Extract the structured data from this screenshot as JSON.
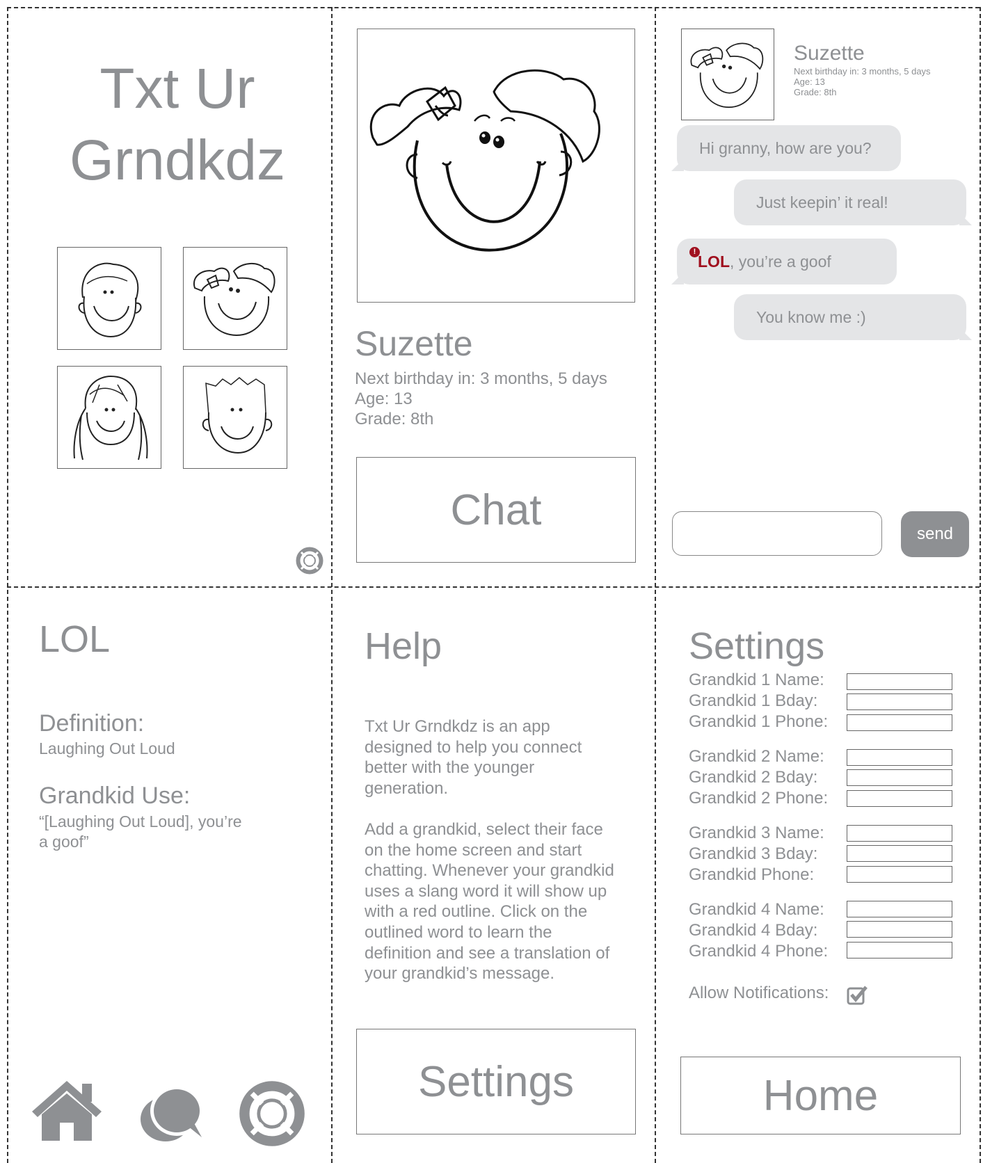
{
  "home": {
    "title_line1": "Txt Ur",
    "title_line2": "Grndkdz",
    "grandkids": [
      {
        "face": "boy-face-icon"
      },
      {
        "face": "girl-bow-face-icon"
      },
      {
        "face": "girl-pigtails-face-icon"
      },
      {
        "face": "boy-spiky-face-icon"
      }
    ],
    "help_icon": "lifebuoy-icon"
  },
  "profile": {
    "name": "Suzette",
    "birthday": "Next birthday in: 3 months, 5 days",
    "age": "Age: 13",
    "grade": "Grade: 8th",
    "chat_button": "Chat"
  },
  "chat": {
    "header": {
      "name": "Suzette",
      "birthday": "Next birthday in: 3 months, 5 days",
      "age": "Age: 13",
      "grade": "Grade: 8th"
    },
    "messages": [
      {
        "from": "grandkid",
        "text": "Hi granny, how are you?"
      },
      {
        "from": "me",
        "text": "Just keepin’ it real!"
      },
      {
        "from": "grandkid",
        "slang": "LOL",
        "rest": ", you’re a goof",
        "alert": "!"
      },
      {
        "from": "me",
        "text": "You know me :)"
      }
    ],
    "input_value": "",
    "send_label": "send"
  },
  "lol": {
    "title": "LOL",
    "definition_label": "Definition:",
    "definition": "Laughing Out Loud",
    "use_label": "Grandkid Use:",
    "use_line1": "“[Laughing Out Loud], you’re",
    "use_line2": "a goof”",
    "nav": [
      "home-icon",
      "chat-icon",
      "lifebuoy-icon"
    ]
  },
  "help": {
    "title": "Help",
    "p1": [
      "Txt Ur Grndkdz is an app",
      "designed to help you connect",
      "better with the younger",
      "generation."
    ],
    "p2": [
      "Add a grandkid, select their face",
      "on the home screen and start",
      "chatting. Whenever your grandkid",
      "uses a slang word it will show up",
      "with a red outline. Click on the",
      "outlined word to learn the",
      "definition and see a translation of",
      "your grandkid’s message."
    ],
    "settings_button": "Settings"
  },
  "settings": {
    "title": "Settings",
    "fields": [
      "Grandkid 1 Name:",
      "Grandkid 1 Bday:",
      "Grandkid 1 Phone:",
      "Grandkid 2 Name:",
      "Grandkid 2 Bday:",
      "Grandkid 2 Phone:",
      "Grandkid 3 Name:",
      "Grandkid 3 Bday:",
      "Grandkid Phone:",
      "Grandkid 4 Name:",
      "Grandkid 4 Bday:",
      "Grandkid 4 Phone:"
    ],
    "notifications_label": "Allow Notifications:",
    "notifications_checked": true,
    "home_button": "Home"
  },
  "colors": {
    "text_gray": "#8e9093",
    "bubble_gray": "#e4e5e7",
    "slang_red": "#a0101f",
    "icon_gray": "#8e9093"
  }
}
